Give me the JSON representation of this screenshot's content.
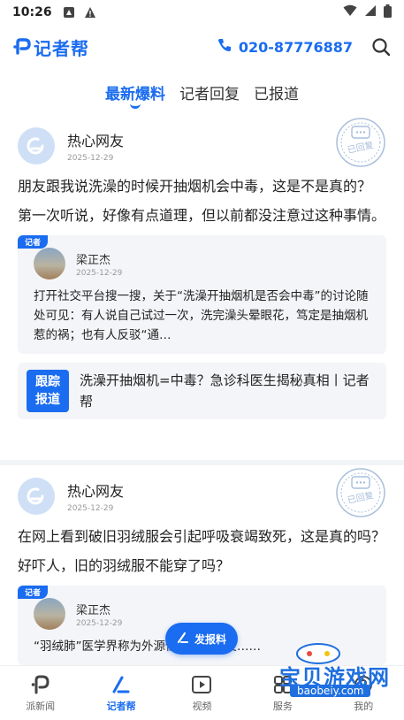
{
  "status_bar": {
    "time": "10:26"
  },
  "header": {
    "logo_text": "记者帮",
    "hotline": "020-87776887"
  },
  "tabs": [
    {
      "label": "最新爆料",
      "active": true
    },
    {
      "label": "记者回复",
      "active": false
    },
    {
      "label": "已报道",
      "active": false
    }
  ],
  "posts": [
    {
      "user": "热心网友",
      "date": "2025-12-29",
      "stamp": "已回复",
      "question": "朋友跟我说洗澡的时候开抽烟机会中毒，这是不是真的？",
      "detail": "第一次听说，好像有点道理，但以前都没注意过这种事情。",
      "reply": {
        "tag": "记者",
        "reporter": "梁正杰",
        "date": "2025-12-29",
        "text": "打开社交平台搜一搜，关于“洗澡开抽烟机是否会中毒”的讨论随处可见：有人说自己试过一次，洗完澡头晕眼花，笃定是抽烟机惹的祸；也有人反驳“通…"
      },
      "follow": {
        "badge_line1": "跟踪",
        "badge_line2": "报道",
        "text": "洗澡开抽烟机=中毒？急诊科医生揭秘真相丨记者帮"
      }
    },
    {
      "user": "热心网友",
      "date": "2025-12-29",
      "stamp": "已回复",
      "question": "在网上看到破旧羽绒服会引起呼吸衰竭致死，这是真的吗？",
      "detail": "好吓人，旧的羽绒服不能穿了吗？",
      "reply": {
        "tag": "记者",
        "reporter": "梁正杰",
        "date": "2025-12-29",
        "text": "“羽绒肺”医学界称为外源性过敏肺泡炎……"
      }
    }
  ],
  "fab": {
    "label": "发报料"
  },
  "bottom_nav": [
    {
      "label": "派新闻",
      "icon": "p-logo-icon",
      "active": false
    },
    {
      "label": "记者帮",
      "icon": "reporter-pen-icon",
      "active": true
    },
    {
      "label": "视频",
      "icon": "video-play-icon",
      "active": false
    },
    {
      "label": "服务",
      "icon": "service-icon",
      "active": false
    },
    {
      "label": "我的",
      "icon": "profile-icon",
      "active": false
    }
  ],
  "watermark": {
    "title": "宝贝游戏网",
    "url": "baobeiy.com"
  },
  "colors": {
    "accent": "#1a6cf0",
    "card_bg": "#f4f5f8"
  }
}
